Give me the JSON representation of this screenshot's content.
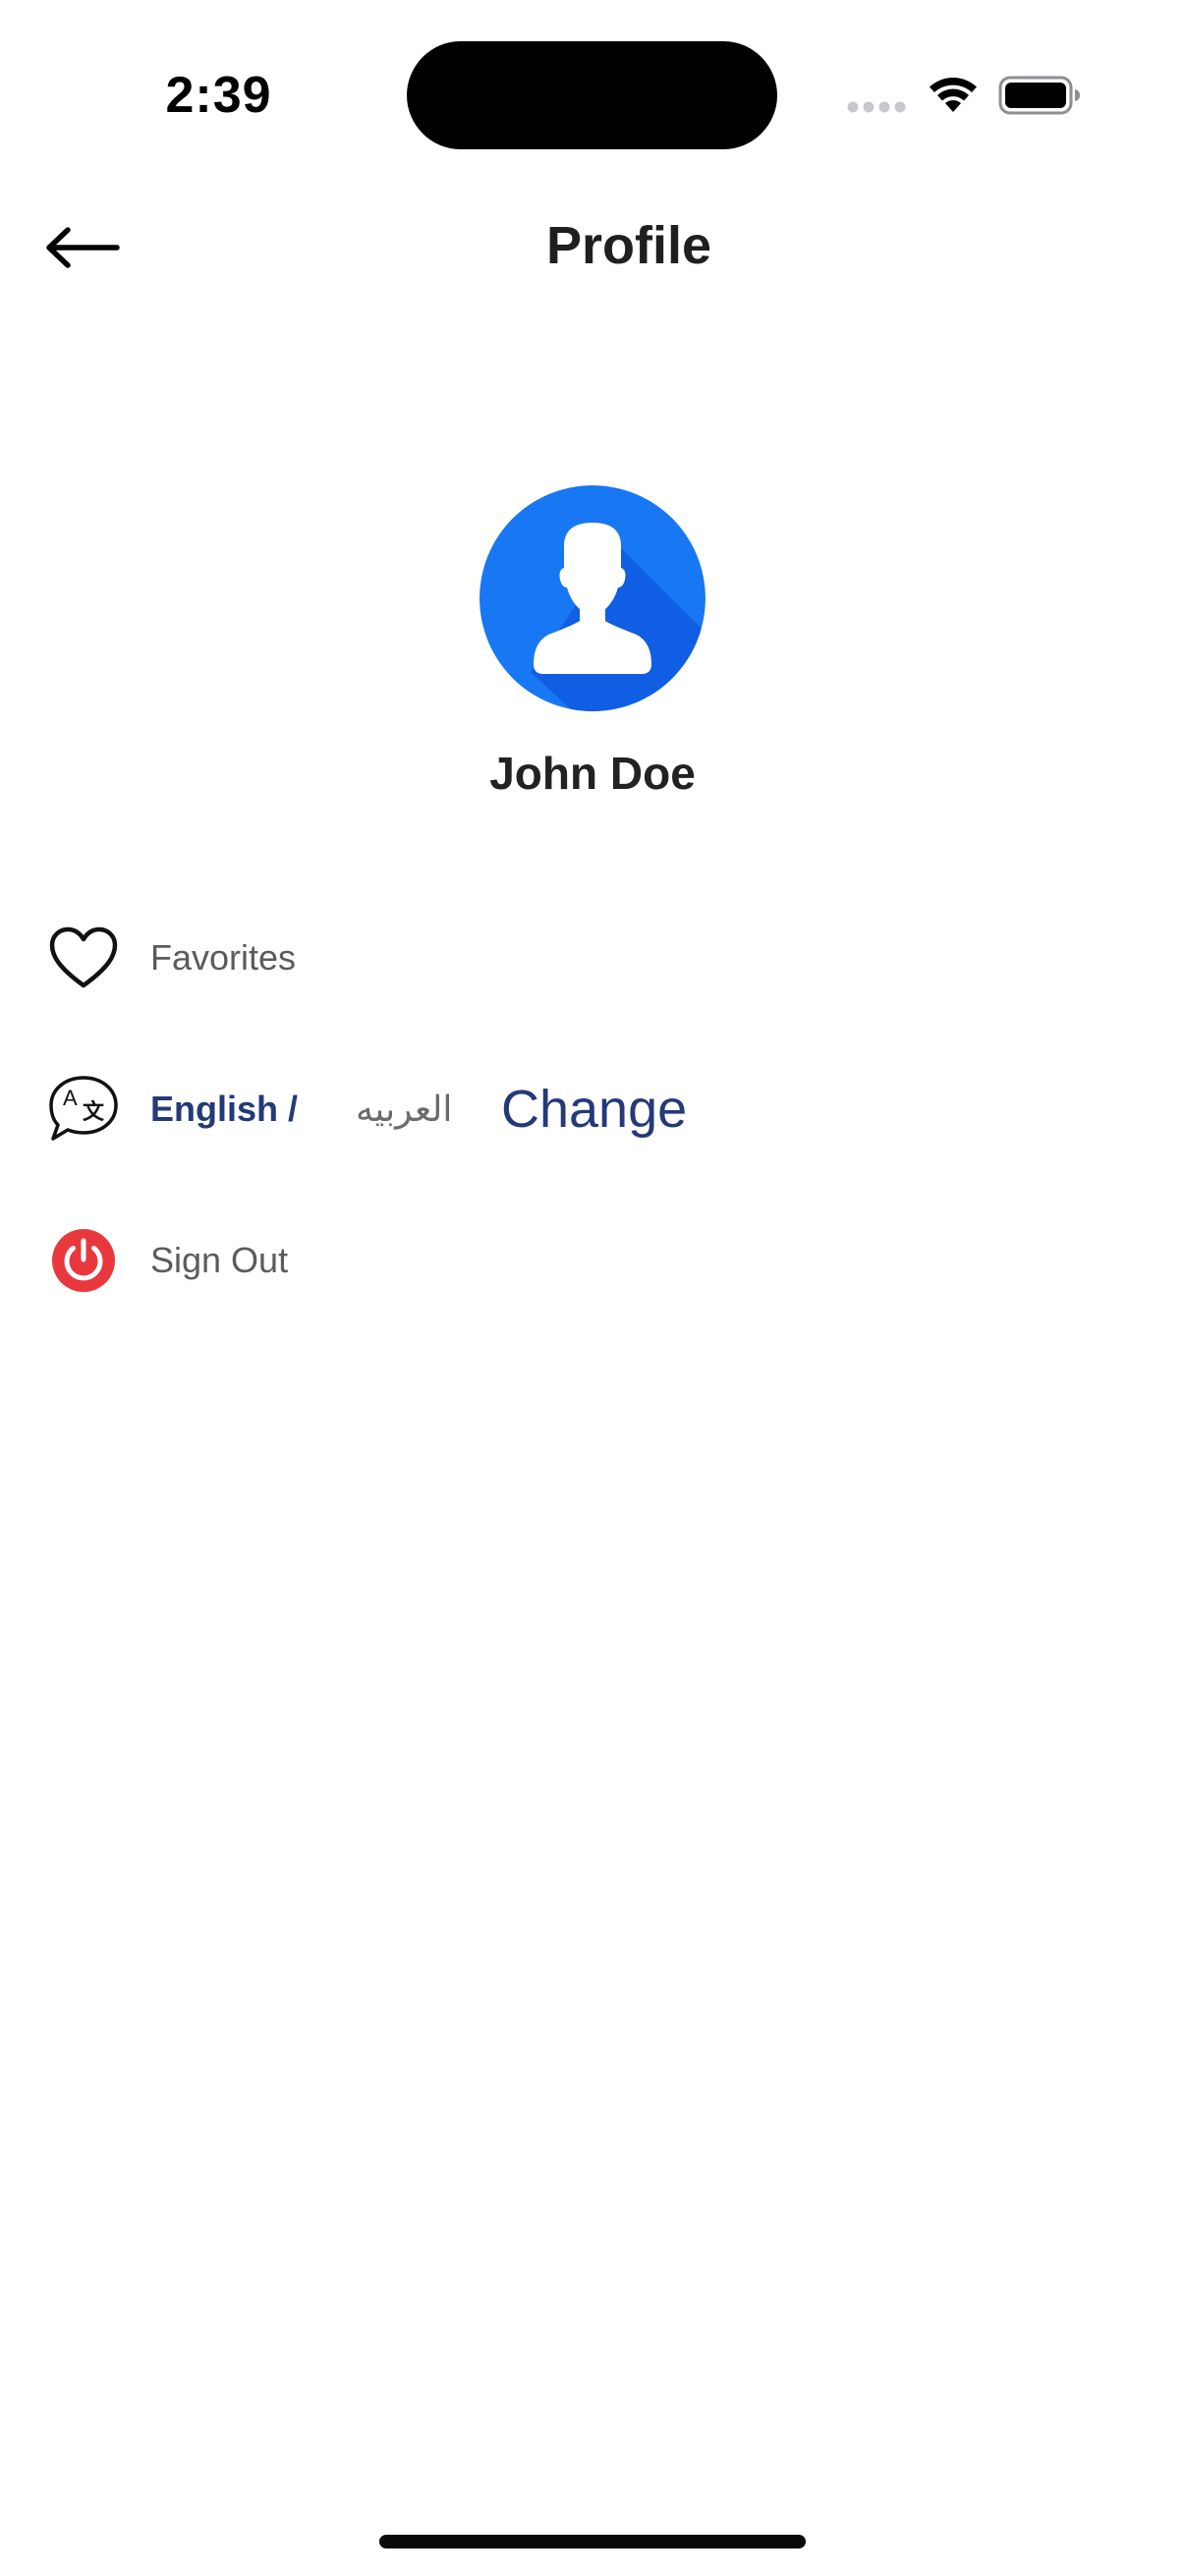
{
  "status_bar": {
    "time": "2:39"
  },
  "header": {
    "title": "Profile",
    "back_icon": "arrow-left-icon"
  },
  "profile": {
    "name": "John Doe",
    "avatar_icon": "user-silhouette-icon",
    "avatar_color": "#1877f2"
  },
  "menu": {
    "favorites": {
      "label": "Favorites",
      "icon": "heart-icon"
    },
    "language": {
      "english_label": "English /",
      "arabic_label": "العربيه",
      "change_label": "Change",
      "icon": "translate-icon",
      "accent_color": "#243a78"
    },
    "sign_out": {
      "label": "Sign Out",
      "icon": "power-icon",
      "icon_color": "#e8383d"
    }
  }
}
